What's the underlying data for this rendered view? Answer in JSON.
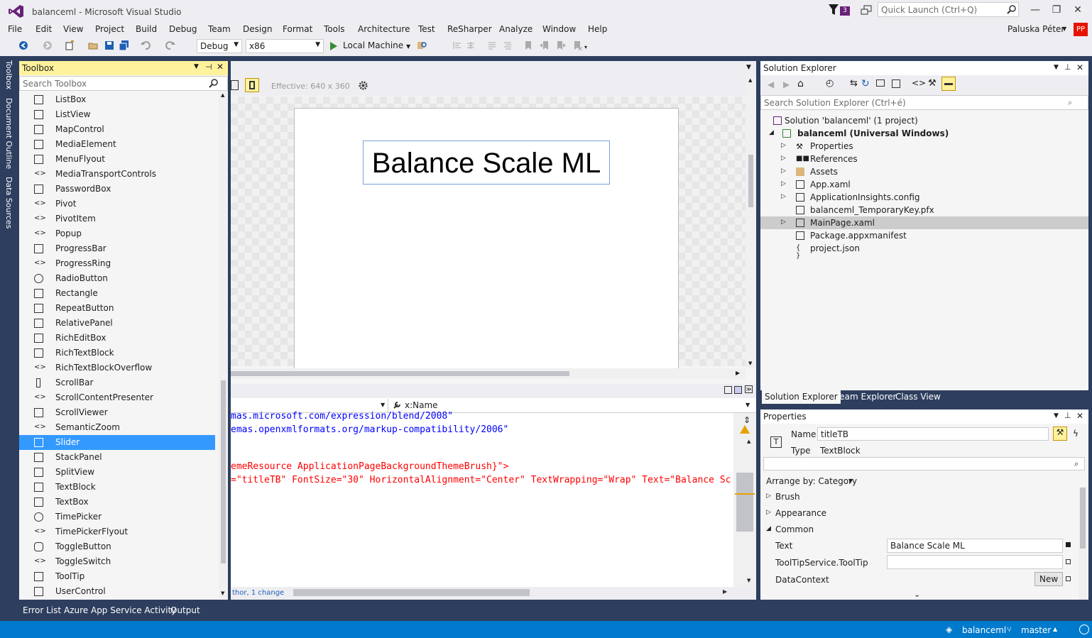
{
  "window": {
    "title": "balanceml - Microsoft Visual Studio",
    "notification_count": "3",
    "quick_launch_placeholder": "Quick Launch (Ctrl+Q)",
    "user_name": "Paluska Péter",
    "user_initials": "PP"
  },
  "menu": [
    "File",
    "Edit",
    "View",
    "Project",
    "Build",
    "Debug",
    "Team",
    "Design",
    "Format",
    "Tools",
    "Architecture",
    "Test",
    "ReSharper",
    "Analyze",
    "Window",
    "Help"
  ],
  "toolbar": {
    "config": "Debug",
    "platform": "x86",
    "run_label": "Local Machine"
  },
  "side_tabs": [
    "Toolbox",
    "Document Outline",
    "Data Sources"
  ],
  "toolbox": {
    "title": "Toolbox",
    "search_placeholder": "Search Toolbox",
    "items": [
      "ListBox",
      "ListView",
      "MapControl",
      "MediaElement",
      "MenuFlyout",
      "MediaTransportControls",
      "PasswordBox",
      "Pivot",
      "PivotItem",
      "Popup",
      "ProgressBar",
      "ProgressRing",
      "RadioButton",
      "Rectangle",
      "RepeatButton",
      "RelativePanel",
      "RichEditBox",
      "RichTextBlock",
      "RichTextBlockOverflow",
      "ScrollBar",
      "ScrollContentPresenter",
      "ScrollViewer",
      "SemanticZoom",
      "Slider",
      "StackPanel",
      "SplitView",
      "TextBlock",
      "TextBox",
      "TimePicker",
      "TimePickerFlyout",
      "ToggleButton",
      "ToggleSwitch",
      "ToolTip",
      "UserControl"
    ],
    "selected": "Slider"
  },
  "designer": {
    "effective_size": "Effective: 640 x 360",
    "title_text": "Balance Scale ML"
  },
  "editor": {
    "nav_right": "x:Name",
    "lines": [
      {
        "text": "mas.microsoft.com/expression/blend/2008\""
      },
      {
        "text": "emas.openxmlformats.org/markup-compatibility/2006\""
      },
      {
        "text": "emeResource ApplicationPageBackgroundThemeBrush}\">"
      },
      {
        "text": "=\"titleTB\" FontSize=\"30\" HorizontalAlignment=\"Center\" TextWrapping=\"Wrap\" Text=\"Balance Sc"
      }
    ],
    "status": "thor, 1 change"
  },
  "solution_explorer": {
    "title": "Solution Explorer",
    "search_placeholder": "Search Solution Explorer (Ctrl+é)",
    "tree": [
      {
        "label": "Solution 'balanceml' (1 project)",
        "indent": 0
      },
      {
        "label": "balanceml (Universal Windows)",
        "indent": 1,
        "bold": true
      },
      {
        "label": "Properties",
        "indent": 2
      },
      {
        "label": "References",
        "indent": 2
      },
      {
        "label": "Assets",
        "indent": 2
      },
      {
        "label": "App.xaml",
        "indent": 2
      },
      {
        "label": "ApplicationInsights.config",
        "indent": 2
      },
      {
        "label": "balanceml_TemporaryKey.pfx",
        "indent": 2
      },
      {
        "label": "MainPage.xaml",
        "indent": 2,
        "selected": true
      },
      {
        "label": "Package.appxmanifest",
        "indent": 2
      },
      {
        "label": "project.json",
        "indent": 2
      }
    ],
    "tabs": [
      "Solution Explorer",
      "Team Explorer",
      "Class View"
    ]
  },
  "properties": {
    "title": "Properties",
    "name_label": "Name",
    "name_value": "titleTB",
    "type_label": "Type",
    "type_value": "TextBlock",
    "arrange_by": "Arrange by: Category",
    "categories": [
      "Brush",
      "Appearance",
      "Common"
    ],
    "text_label": "Text",
    "text_value": "Balance Scale ML",
    "tooltip_label": "ToolTipService.ToolTip",
    "datacontext_label": "DataContext",
    "new_button": "New"
  },
  "bottom_tabs": [
    "Error List",
    "Azure App Service Activity",
    "Output"
  ],
  "status": {
    "repo": "balanceml",
    "branch": "master"
  },
  "colors": {
    "accent": "#007acc",
    "frame": "#2d3e5e",
    "toolbox_header": "#fff29d",
    "selection": "#3399ff"
  }
}
